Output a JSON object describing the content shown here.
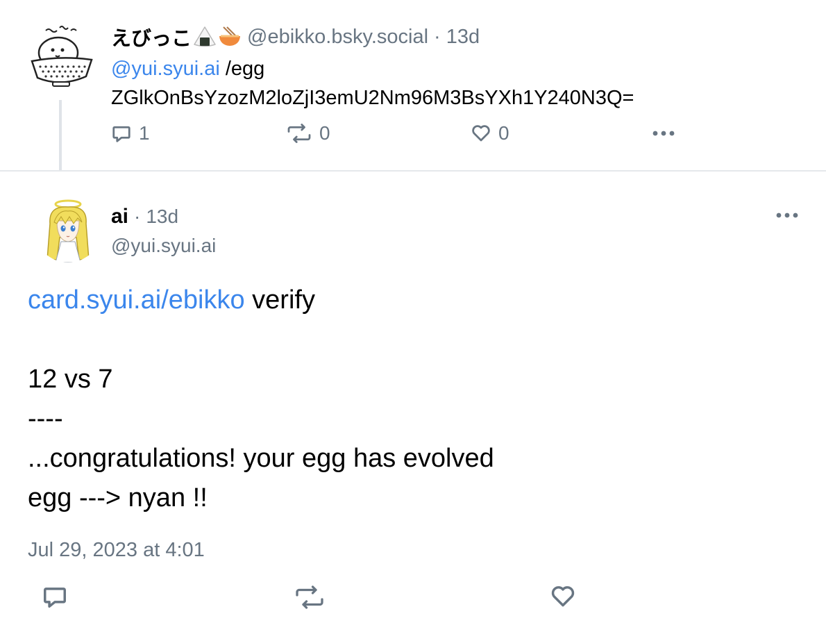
{
  "parent_post": {
    "display_name": "えびっこ",
    "name_emojis": [
      "rice-ball-emoji",
      "noodle-bowl-emoji"
    ],
    "handle": "@ebikko.bsky.social",
    "separator": "·",
    "age": "13d",
    "mention": "@yui.syui.ai",
    "command": " /egg",
    "code": "ZGlkOnBsYzozM2loZjI3emU2Nm96M3BsYXh1Y240N3Q=",
    "actions": {
      "reply_count": "1",
      "repost_count": "0",
      "like_count": "0"
    }
  },
  "main_post": {
    "display_name": "ai",
    "separator": "·",
    "age": "13d",
    "handle": "@yui.syui.ai",
    "link_text": "card.syui.ai/ebikko",
    "link_suffix": " verify",
    "lines": [
      "12 vs 7",
      "----",
      "...congratulations! your egg has evolved",
      "egg ---> nyan !!"
    ],
    "timestamp": "Jul 29, 2023 at 4:01"
  },
  "colors": {
    "link": "#3b86ec",
    "muted": "#687582",
    "divider": "#e5e8eb",
    "thread_line": "#dfe3e8"
  }
}
